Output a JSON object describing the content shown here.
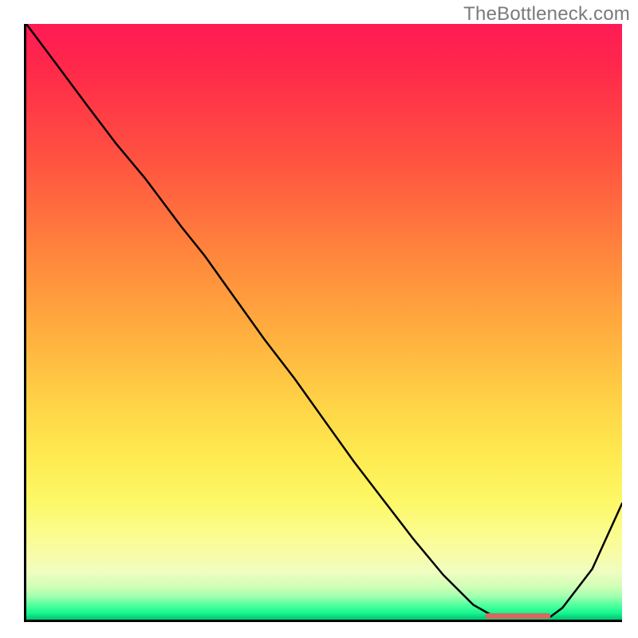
{
  "watermark": "TheBottleneck.com",
  "chart_data": {
    "type": "line",
    "title": "",
    "xlabel": "",
    "ylabel": "",
    "x": [
      0.0,
      0.05,
      0.1,
      0.15,
      0.2,
      0.23,
      0.26,
      0.3,
      0.35,
      0.4,
      0.45,
      0.5,
      0.55,
      0.6,
      0.65,
      0.7,
      0.75,
      0.78,
      0.8,
      0.82,
      0.84,
      0.86,
      0.88,
      0.9,
      0.95,
      1.0
    ],
    "series": [
      {
        "name": "curve",
        "values": [
          1.0,
          0.933,
          0.866,
          0.8,
          0.74,
          0.7,
          0.66,
          0.61,
          0.54,
          0.47,
          0.405,
          0.335,
          0.265,
          0.2,
          0.135,
          0.075,
          0.025,
          0.008,
          0.004,
          0.003,
          0.003,
          0.003,
          0.005,
          0.02,
          0.085,
          0.195
        ]
      }
    ],
    "xlim": [
      0,
      1
    ],
    "ylim": [
      0,
      1
    ],
    "marker": {
      "x_start": 0.77,
      "x_end": 0.88,
      "y": 0.006,
      "color": "#d46a5f"
    },
    "gradient_note": "background encodes bottleneck severity: top red = severe, bottom green = none"
  },
  "colors": {
    "axis": "#000000",
    "curve": "#000000",
    "marker": "#d46a5f",
    "watermark": "#7a7a7a"
  }
}
